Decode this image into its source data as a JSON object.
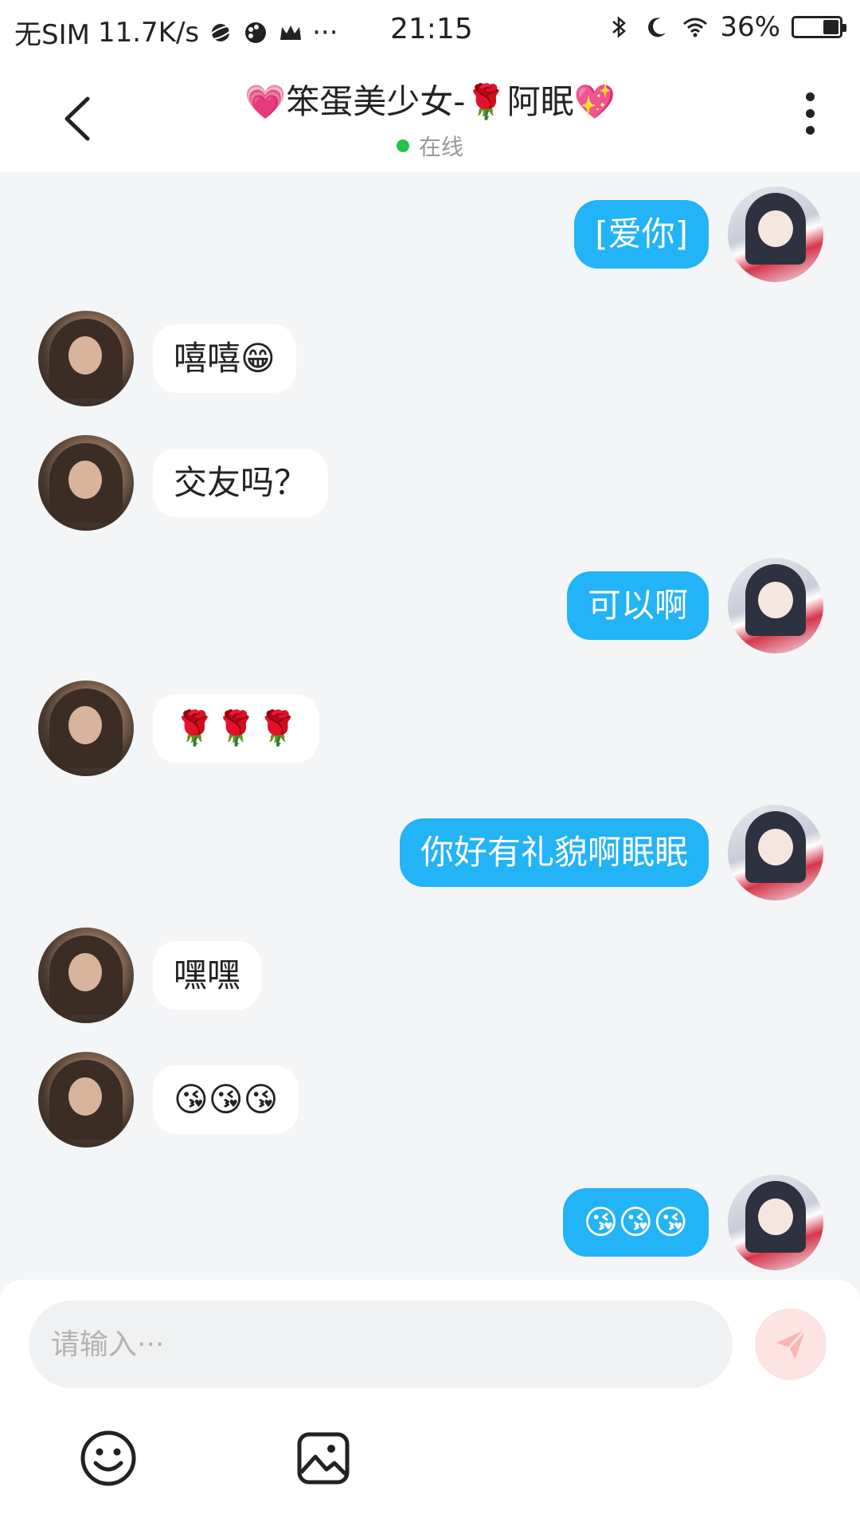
{
  "status_bar": {
    "carrier": "无SIM",
    "speed": "11.7K/s",
    "time": "21:15",
    "battery_percent_text": "36%",
    "battery_level": 0.36
  },
  "header": {
    "title": "💗笨蛋美少女-🌹阿眠💖",
    "status": "在线",
    "status_color": "#27c24c"
  },
  "messages": [
    {
      "side": "right",
      "text": "[爱你]"
    },
    {
      "side": "left",
      "text": "嘻嘻😁"
    },
    {
      "side": "left",
      "text": "交友吗？"
    },
    {
      "side": "right",
      "text": "可以啊"
    },
    {
      "side": "left",
      "text": "🌹🌹🌹"
    },
    {
      "side": "right",
      "text": "你好有礼貌啊眠眠"
    },
    {
      "side": "left",
      "text": "嘿嘿"
    },
    {
      "side": "left",
      "text": "😘😘😘"
    },
    {
      "side": "right",
      "text": "😘😘😘"
    }
  ],
  "composer": {
    "placeholder": "请输入···",
    "value": "",
    "send_icon": "send-icon",
    "tools": [
      "emoji-icon",
      "image-icon"
    ]
  },
  "colors": {
    "my_bubble": "#23b3f7",
    "their_bubble": "#ffffff",
    "background": "#f3f5f7",
    "send_button": "#fde3e1"
  }
}
